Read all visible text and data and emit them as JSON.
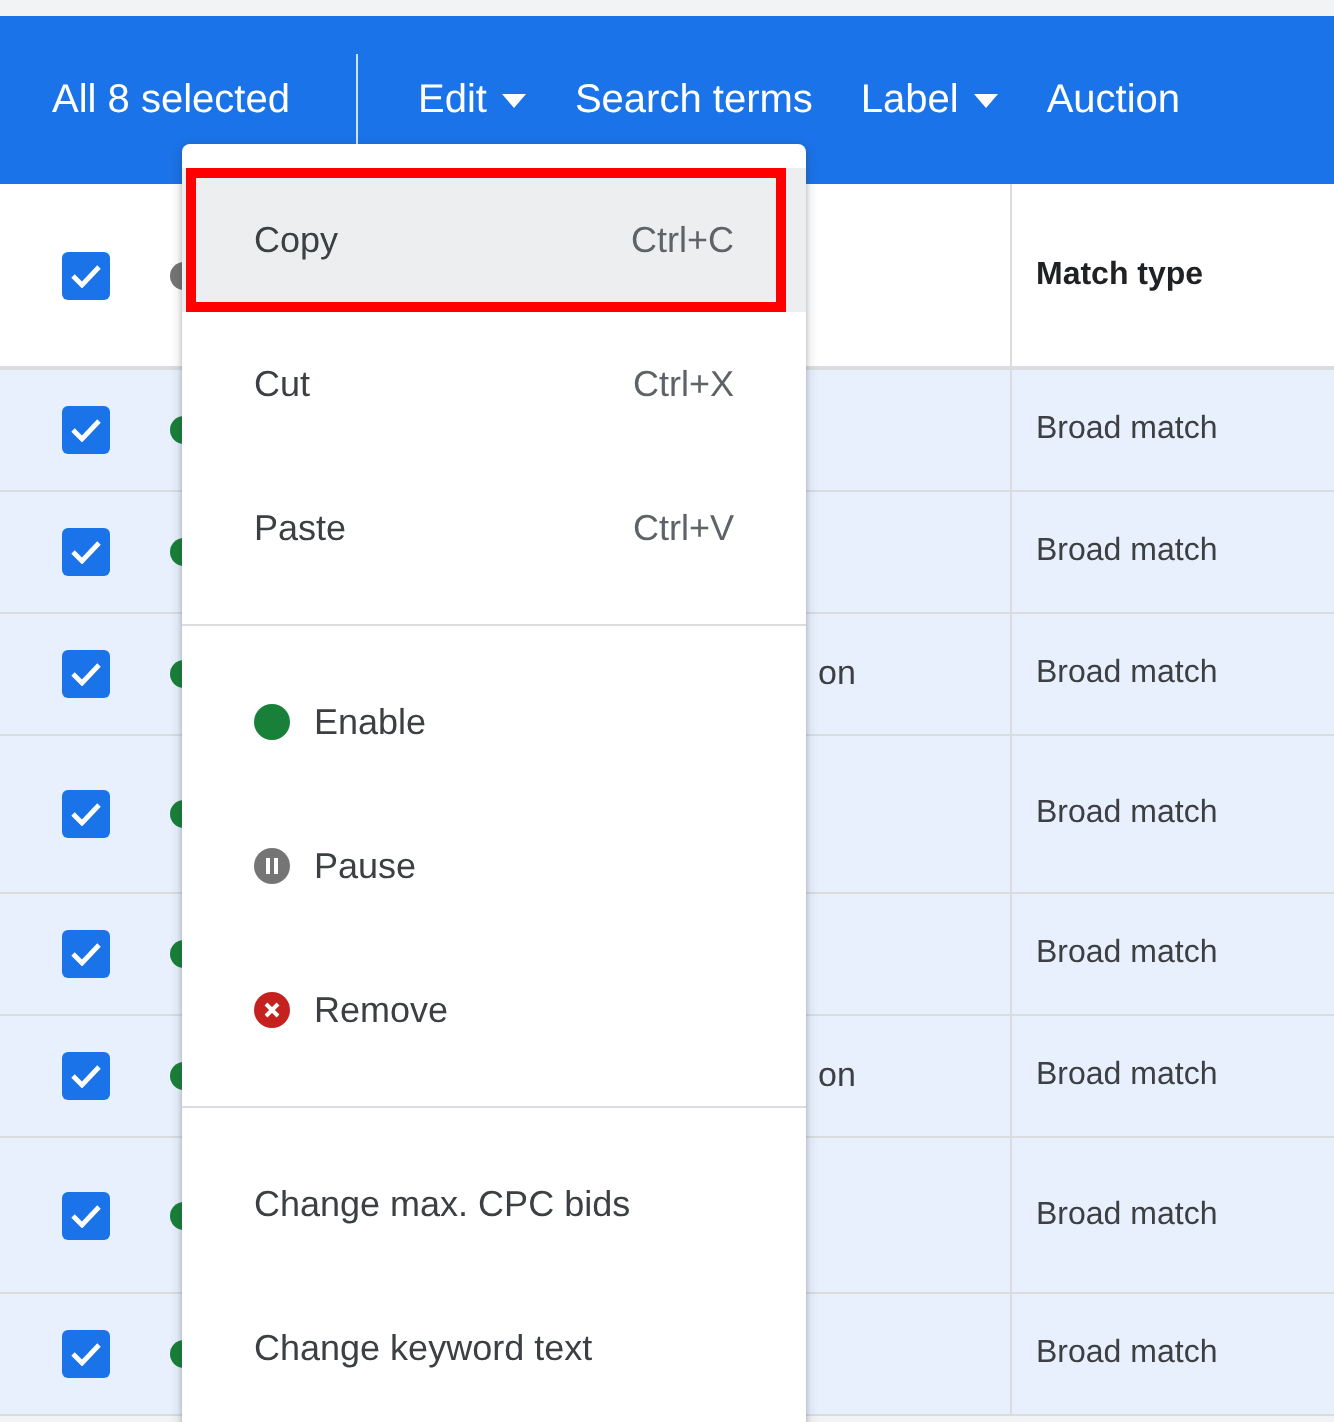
{
  "toolbar": {
    "selection_label": "All 8 selected",
    "actions": [
      {
        "label": "Edit",
        "dropdown": true
      },
      {
        "label": "Search terms",
        "dropdown": false
      },
      {
        "label": "Label",
        "dropdown": true
      },
      {
        "label": "Auction",
        "dropdown": false
      }
    ]
  },
  "table": {
    "header": {
      "checked": true,
      "columns": [
        "Match type"
      ]
    },
    "rows": [
      {
        "checked": true,
        "kind": "enabled",
        "match_type": "Broad match"
      },
      {
        "checked": true,
        "kind": "enabled",
        "match_type": "Broad match"
      },
      {
        "checked": true,
        "kind": "enabled",
        "keyword": "on",
        "match_type": "Broad match"
      },
      {
        "checked": true,
        "kind": "enabled",
        "match_type": "Broad match"
      },
      {
        "checked": true,
        "kind": "enabled",
        "match_type": "Broad match"
      },
      {
        "checked": true,
        "kind": "enabled",
        "keyword": "on",
        "match_type": "Broad match"
      },
      {
        "checked": true,
        "kind": "enabled",
        "match_type": "Broad match"
      },
      {
        "checked": true,
        "kind": "enabled",
        "match_type": "Broad match"
      }
    ]
  },
  "menu": {
    "sections": [
      [
        {
          "label": "Copy",
          "shortcut": "Ctrl+C",
          "selected": true,
          "annotated": true
        },
        {
          "label": "Cut",
          "shortcut": "Ctrl+X",
          "selected": false,
          "annotated": false
        },
        {
          "label": "Paste",
          "shortcut": "Ctrl+V",
          "selected": false,
          "annotated": false
        }
      ],
      [
        {
          "label": "Enable",
          "kind": "enabled",
          "selected": false,
          "annotated": false
        },
        {
          "label": "Pause",
          "kind": "paused",
          "selected": false,
          "annotated": false
        },
        {
          "label": "Remove",
          "kind": "removed",
          "selected": false,
          "annotated": false
        }
      ],
      [
        {
          "label": "Change max. CPC bids",
          "selected": false,
          "annotated": false
        },
        {
          "label": "Change keyword text",
          "selected": false,
          "annotated": false
        }
      ]
    ]
  }
}
